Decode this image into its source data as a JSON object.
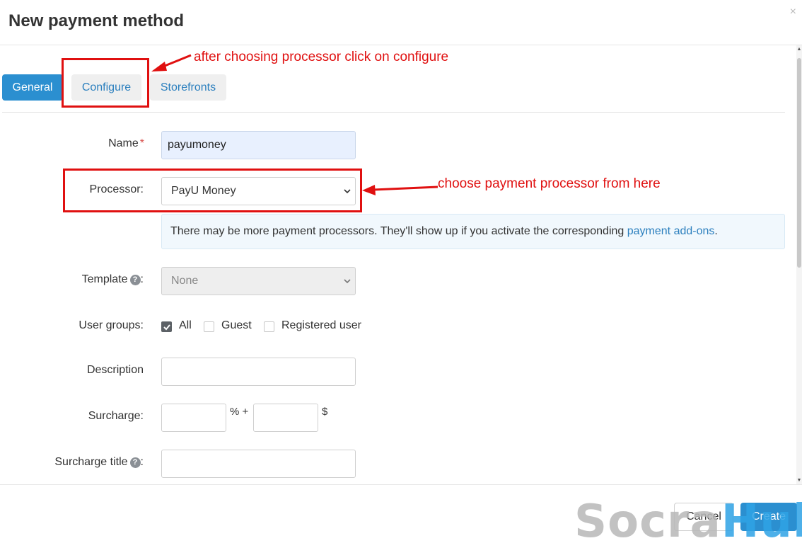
{
  "dialog": {
    "title": "New payment method",
    "close_glyph": "×"
  },
  "tabs": [
    {
      "label": "General",
      "active": true
    },
    {
      "label": "Configure",
      "active": false
    },
    {
      "label": "Storefronts",
      "active": false
    }
  ],
  "form": {
    "name_label": "Name",
    "name_required_mark": "*",
    "name_value": "payumoney",
    "processor_label": "Processor:",
    "processor_value": "PayU Money",
    "notice_text": "There may be more payment processors. They'll show up if you activate the corresponding ",
    "notice_link": "payment add-ons",
    "notice_end": ".",
    "template_label": "Template",
    "template_colon": ":",
    "template_value": "None",
    "user_groups_label": "User groups:",
    "user_groups": [
      {
        "label": "All",
        "checked": true
      },
      {
        "label": "Guest",
        "checked": false
      },
      {
        "label": "Registered user",
        "checked": false
      }
    ],
    "description_label": "Description",
    "description_value": "",
    "surcharge_label": "Surcharge:",
    "surcharge_percent_unit": "% +",
    "surcharge_currency_unit": "$",
    "surcharge_percent_value": "",
    "surcharge_amount_value": "",
    "surcharge_title_label": "Surcharge title",
    "surcharge_title_colon": ":",
    "surcharge_title_value": "",
    "help_glyph": "?"
  },
  "footer": {
    "cancel_label": "Cancel",
    "create_label": "Create"
  },
  "annotations": {
    "configure_note": "after choosing processor click on configure",
    "processor_note": "choose payment processor from here"
  },
  "watermark": {
    "part1": "Socra",
    "part2": "Hub"
  },
  "colors": {
    "primary": "#2b8fd0",
    "annotation": "#e01010",
    "link": "#2b7fbe"
  },
  "icons": {
    "help": "question-circle-icon",
    "dropdown": "chevron-down-icon",
    "checkbox": "check-icon",
    "close": "close-icon"
  }
}
